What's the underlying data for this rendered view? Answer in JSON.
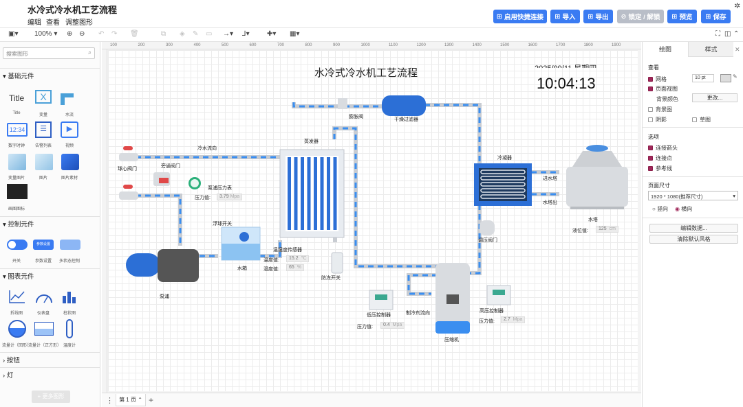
{
  "header": {
    "title": "水冷式冷水机工艺流程",
    "menus": [
      "编辑",
      "查看",
      "调整图形"
    ],
    "buttons": {
      "quick_connect": "启用快捷连接",
      "import": "导入",
      "export": "导出",
      "lock": "锁定 / 解锁",
      "preview": "预览",
      "save": "保存"
    }
  },
  "toolbar": {
    "zoom": "100%"
  },
  "sidebar": {
    "search_placeholder": "搜索图形",
    "sections": {
      "basic": "基础元件",
      "control": "控制元件",
      "chart": "图表元件",
      "button": "按钮",
      "light": "灯",
      "more": "更多图形"
    },
    "basic_items": [
      "Title",
      "变量",
      "水流",
      "数字时钟",
      "告警列表",
      "视频",
      "变量图片",
      "图片",
      "图片素材",
      "画图图标"
    ],
    "title_glyph": "Title",
    "var_glyph": "X",
    "clock_glyph": "12:34",
    "control_items": [
      "开关",
      "参数设置",
      "多状态控制"
    ],
    "control_btn": "参数设置",
    "chart_items": [
      "折线图",
      "仪表盘",
      "柱状图",
      "流量计（回形）",
      "流量计（正方形）",
      "温度计"
    ]
  },
  "ruler": [
    "100",
    "200",
    "300",
    "400",
    "500",
    "600",
    "700",
    "800",
    "900",
    "1000",
    "1100",
    "1200",
    "1300",
    "1400",
    "1500",
    "1600",
    "1700",
    "1800",
    "1900"
  ],
  "diagram": {
    "title": "水冷式冷水机工艺流程",
    "date": "2025/09/11 星期四",
    "time": "10:04:13",
    "labels": {
      "cold_in": "冷水流向",
      "ball_valve": "球心阀门",
      "bypass": "旁通阀门",
      "pump_gauge": "泵浦压力表",
      "pressure": "压力值:",
      "pump_pressure": "3.79",
      "mpa": "Mpa",
      "float_switch": "浮球开关",
      "tank": "水箱",
      "pump": "泵浦",
      "evaporator": "蒸发器",
      "sensor": "温湿度传感器",
      "temp": "温度值:",
      "temp_val": "15.2",
      "temp_unit": "℃",
      "hum": "湿度值:",
      "hum_val": "65",
      "hum_unit": "%",
      "antifreeze": "防冻开关",
      "expansion": "膨胀阀",
      "filter": "干燥过滤器",
      "condenser": "冷凝器",
      "in_tower": "进水塔",
      "out_tower": "水塔出",
      "tower": "水塔",
      "level": "液位值:",
      "level_val": "125",
      "level_unit": "cm",
      "regulator": "调压阀门",
      "low_ctrl": "低压控制器",
      "low_val": "0.4",
      "refrig": "制冷剂流向",
      "compressor": "压缩机",
      "high_ctrl": "高压控制器",
      "high_val": "2.7"
    }
  },
  "rightpanel": {
    "tabs": [
      "绘图",
      "样式"
    ],
    "view": "查看",
    "grid": "网格",
    "grid_val": "10 pt",
    "page_view": "页面视图",
    "bg_color": "背景颜色",
    "change": "更改...",
    "bg_image": "背景图",
    "shadow": "阴影",
    "sketch": "草图",
    "options": "选项",
    "conn_arrow": "连接箭头",
    "conn_point": "连接点",
    "guides": "参考线",
    "page_size": "页面尺寸",
    "size_val": "1920 * 1080(推荐尺寸)",
    "portrait": "竖向",
    "landscape": "横向",
    "edit_data": "编辑数据...",
    "clear_style": "清除默认风格"
  },
  "footer": {
    "page_tab": "第 1 页"
  }
}
